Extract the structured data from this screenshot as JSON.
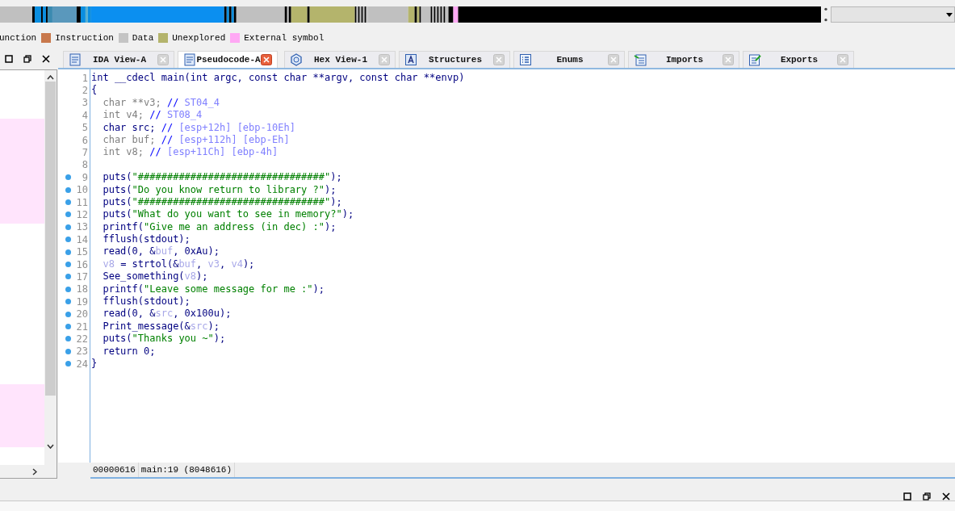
{
  "legend": [
    {
      "label": "unction"
    },
    {
      "label": "Instruction",
      "color": "#c8784c"
    },
    {
      "label": "Data",
      "color": "#c4c4c4"
    },
    {
      "label": "Unexplored",
      "color": "#b4b46c"
    },
    {
      "label": "External symbol",
      "color": "#ffa8f4"
    }
  ],
  "tabs": [
    {
      "label": "IDA View-A",
      "selected": false
    },
    {
      "label": "Pseudocode-A",
      "selected": true
    },
    {
      "label": "Hex View-1",
      "selected": false
    },
    {
      "label": "Structures",
      "selected": false
    },
    {
      "label": "Enums",
      "selected": false
    },
    {
      "label": "Imports",
      "selected": false
    },
    {
      "label": "Exports",
      "selected": false
    }
  ],
  "code": {
    "lines": [
      {
        "number": "1",
        "marked": false,
        "tokens": [
          {
            "kind": "kw",
            "text": "int __cdecl main(int argc, const char **argv, const char **envp)"
          }
        ]
      },
      {
        "number": "2",
        "marked": false,
        "tokens": [
          {
            "kind": "kw",
            "text": "{"
          }
        ]
      },
      {
        "number": "3",
        "marked": false,
        "tokens": [
          {
            "kind": "dim",
            "text": "  char **v3; "
          },
          {
            "kind": "sep",
            "text": "// "
          },
          {
            "kind": "note",
            "text": "ST04_4"
          }
        ]
      },
      {
        "number": "4",
        "marked": false,
        "tokens": [
          {
            "kind": "dim",
            "text": "  int v4; "
          },
          {
            "kind": "sep",
            "text": "// "
          },
          {
            "kind": "note",
            "text": "ST08_4"
          }
        ]
      },
      {
        "number": "5",
        "marked": false,
        "tokens": [
          {
            "kind": "kw",
            "text": "  char src; "
          },
          {
            "kind": "sep",
            "text": "// "
          },
          {
            "kind": "note",
            "text": "[esp+12h] [ebp-10Eh]"
          }
        ]
      },
      {
        "number": "6",
        "marked": false,
        "tokens": [
          {
            "kind": "dim",
            "text": "  char buf; "
          },
          {
            "kind": "sep",
            "text": "// "
          },
          {
            "kind": "note",
            "text": "[esp+112h] [ebp-Eh]"
          }
        ]
      },
      {
        "number": "7",
        "marked": false,
        "tokens": [
          {
            "kind": "dim",
            "text": "  int v8; "
          },
          {
            "kind": "sep",
            "text": "// "
          },
          {
            "kind": "note",
            "text": "[esp+11Ch] [ebp-4h]"
          }
        ]
      },
      {
        "number": "8",
        "marked": false
      },
      {
        "number": "9",
        "marked": true,
        "tokens": [
          {
            "kind": "kw",
            "text": "  puts("
          },
          {
            "kind": "str",
            "text": "\"################################\""
          },
          {
            "kind": "kw",
            "text": ");"
          }
        ]
      },
      {
        "number": "10",
        "marked": true,
        "tokens": [
          {
            "kind": "kw",
            "text": "  puts("
          },
          {
            "kind": "str",
            "text": "\"Do you know return to library ?\""
          },
          {
            "kind": "kw",
            "text": ");"
          }
        ]
      },
      {
        "number": "11",
        "marked": true,
        "tokens": [
          {
            "kind": "kw",
            "text": "  puts("
          },
          {
            "kind": "str",
            "text": "\"################################\""
          },
          {
            "kind": "kw",
            "text": ");"
          }
        ]
      },
      {
        "number": "12",
        "marked": true,
        "tokens": [
          {
            "kind": "kw",
            "text": "  puts("
          },
          {
            "kind": "str",
            "text": "\"What do you want to see in memory?\""
          },
          {
            "kind": "kw",
            "text": ");"
          }
        ]
      },
      {
        "number": "13",
        "marked": true,
        "tokens": [
          {
            "kind": "kw",
            "text": "  printf("
          },
          {
            "kind": "str",
            "text": "\"Give me an address (in dec) :\""
          },
          {
            "kind": "kw",
            "text": ");"
          }
        ]
      },
      {
        "number": "14",
        "marked": true,
        "tokens": [
          {
            "kind": "kw",
            "text": "  fflush(stdout);"
          }
        ]
      },
      {
        "number": "15",
        "marked": true,
        "tokens": [
          {
            "kind": "kw",
            "text": "  read(0, &"
          },
          {
            "kind": "var",
            "text": "buf"
          },
          {
            "kind": "kw",
            "text": ", 0xAu);"
          }
        ]
      },
      {
        "number": "16",
        "marked": true,
        "tokens": [
          {
            "kind": "var",
            "text": "  v8"
          },
          {
            "kind": "kw",
            "text": " = strtol(&"
          },
          {
            "kind": "var",
            "text": "buf"
          },
          {
            "kind": "kw",
            "text": ", "
          },
          {
            "kind": "var",
            "text": "v3"
          },
          {
            "kind": "kw",
            "text": ", "
          },
          {
            "kind": "var",
            "text": "v4"
          },
          {
            "kind": "kw",
            "text": ");"
          }
        ]
      },
      {
        "number": "17",
        "marked": true,
        "tokens": [
          {
            "kind": "kw",
            "text": "  See_something("
          },
          {
            "kind": "var",
            "text": "v8"
          },
          {
            "kind": "kw",
            "text": ");"
          }
        ]
      },
      {
        "number": "18",
        "marked": true,
        "tokens": [
          {
            "kind": "kw",
            "text": "  printf("
          },
          {
            "kind": "str",
            "text": "\"Leave some message for me :\""
          },
          {
            "kind": "kw",
            "text": ");"
          }
        ]
      },
      {
        "number": "19",
        "marked": true,
        "tokens": [
          {
            "kind": "kw",
            "text": "  fflush(stdout);"
          }
        ]
      },
      {
        "number": "20",
        "marked": true,
        "tokens": [
          {
            "kind": "kw",
            "text": "  read(0, &"
          },
          {
            "kind": "var",
            "text": "src"
          },
          {
            "kind": "kw",
            "text": ", 0x100u);"
          }
        ]
      },
      {
        "number": "21",
        "marked": true,
        "tokens": [
          {
            "kind": "kw",
            "text": "  Print_message(&"
          },
          {
            "kind": "var",
            "text": "src"
          },
          {
            "kind": "kw",
            "text": ");"
          }
        ]
      },
      {
        "number": "22",
        "marked": true,
        "tokens": [
          {
            "kind": "kw",
            "text": "  puts("
          },
          {
            "kind": "str",
            "text": "\"Thanks you ~\""
          },
          {
            "kind": "kw",
            "text": ");"
          }
        ]
      },
      {
        "number": "23",
        "marked": true,
        "tokens": [
          {
            "kind": "kw",
            "text": "  return 0;"
          }
        ]
      },
      {
        "number": "24",
        "marked": true,
        "tokens": [
          {
            "kind": "kw",
            "text": "}"
          }
        ]
      }
    ]
  },
  "status_bar": [
    "00000616",
    "main:19 (8048616)"
  ]
}
